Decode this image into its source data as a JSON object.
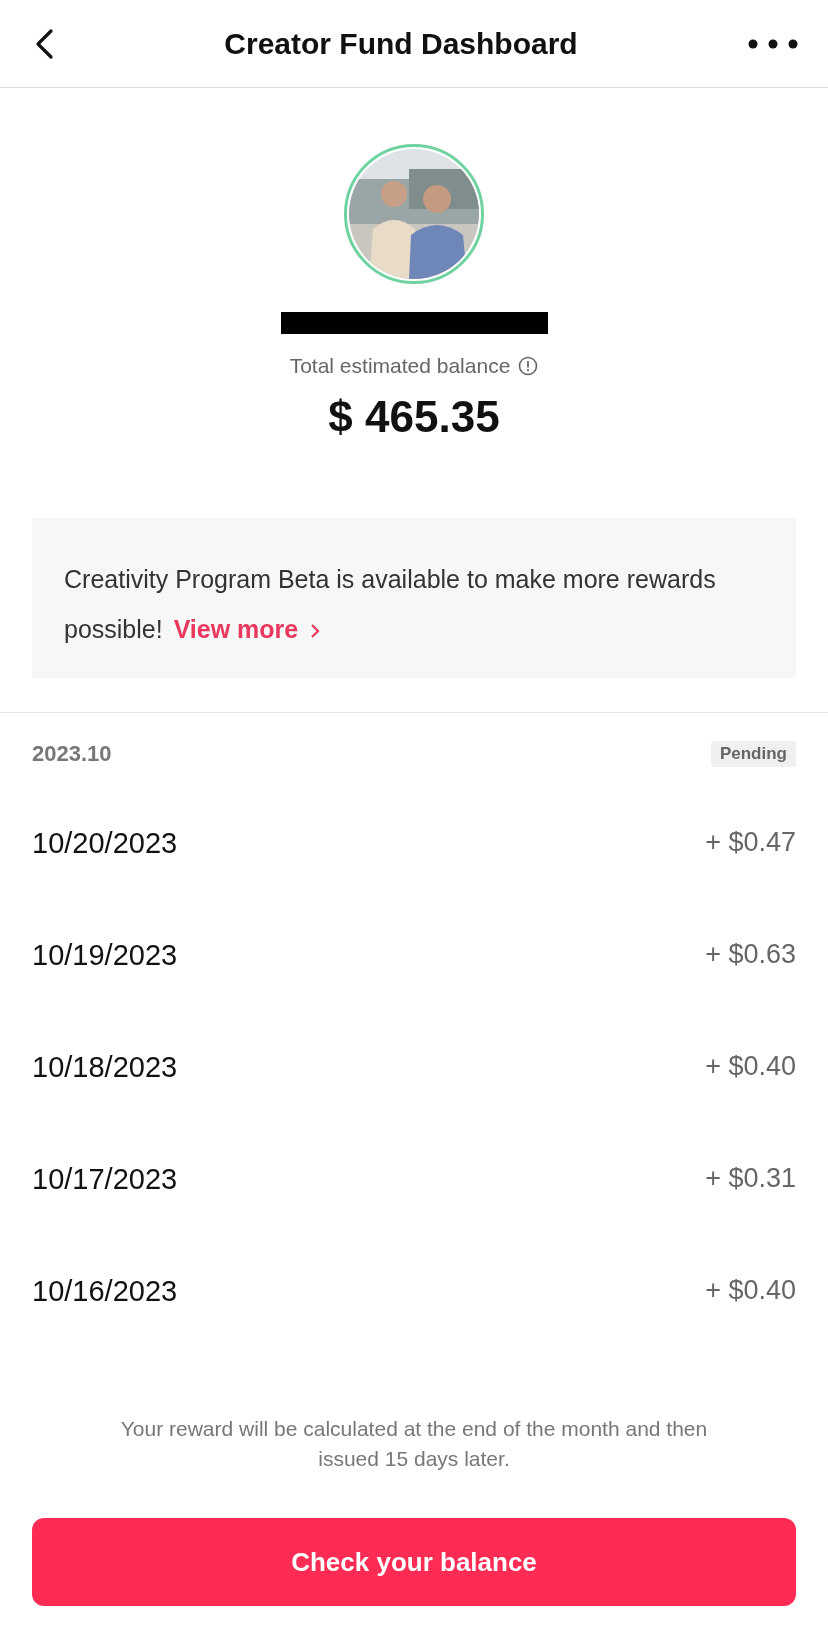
{
  "header": {
    "title": "Creator Fund Dashboard"
  },
  "profile": {
    "balance_label": "Total estimated balance",
    "balance": "$ 465.35"
  },
  "banner": {
    "text": "Creativity Program Beta is available to make more rewards possible!",
    "link": "View more"
  },
  "month": {
    "label": "2023.10",
    "status": "Pending"
  },
  "rows": [
    {
      "date": "10/20/2023",
      "amount": "+ $0.47"
    },
    {
      "date": "10/19/2023",
      "amount": "+ $0.63"
    },
    {
      "date": "10/18/2023",
      "amount": "+ $0.40"
    },
    {
      "date": "10/17/2023",
      "amount": "+ $0.31"
    },
    {
      "date": "10/16/2023",
      "amount": "+ $0.40"
    }
  ],
  "footer": {
    "note": "Your reward will be calculated at the end of the month and then issued 15 days later.",
    "button": "Check your balance"
  }
}
